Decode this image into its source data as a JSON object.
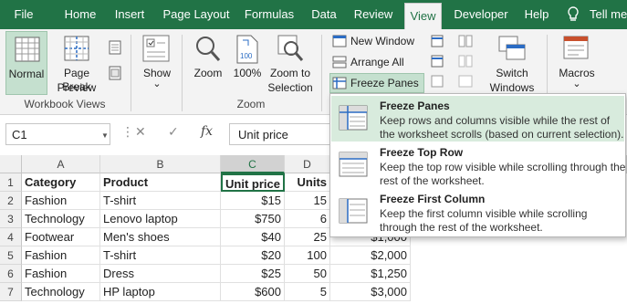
{
  "tabs": [
    "File",
    "Home",
    "Insert",
    "Page Layout",
    "Formulas",
    "Data",
    "Review",
    "View",
    "Developer",
    "Help",
    "Tell me"
  ],
  "active_tab": "View",
  "colors": {
    "brand": "#217346",
    "selected_bg": "#c5e0cf",
    "hover_bg": "#d8ebdd"
  },
  "ribbon": {
    "workbook_views": {
      "normal": "Normal",
      "page_break_line1": "Page Break",
      "page_break_line2": "Preview",
      "label": "Workbook Views"
    },
    "show": {
      "label": "Show",
      "arrow": "⌄"
    },
    "zoom": {
      "zoom": "Zoom",
      "hundred": "100%",
      "zoom_sel_line1": "Zoom to",
      "zoom_sel_line2": "Selection",
      "label": "Zoom"
    },
    "window": {
      "new_window": "New Window",
      "arrange_all": "Arrange All",
      "freeze_panes": "Freeze Panes",
      "switch_line1": "Switch",
      "switch_line2": "Windows"
    },
    "macros": {
      "label": "Macros"
    }
  },
  "formula_bar": {
    "name_box": "C1",
    "fx": "fx",
    "formula": "Unit price"
  },
  "grid": {
    "columns": [
      "A",
      "B",
      "C",
      "D"
    ],
    "selected_column": "C",
    "rows": [
      "1",
      "2",
      "3",
      "4",
      "5",
      "6",
      "7"
    ],
    "header": {
      "a": "Category",
      "b": "Product",
      "c": "Unit price",
      "d": "Units"
    },
    "data": [
      {
        "a": "Fashion",
        "b": "T-shirt",
        "c": "$15",
        "d": "15",
        "e": ""
      },
      {
        "a": "Technology",
        "b": "Lenovo laptop",
        "c": "$750",
        "d": "6",
        "e": ""
      },
      {
        "a": "Footwear",
        "b": "Men's shoes",
        "c": "$40",
        "d": "25",
        "e": "$1,000"
      },
      {
        "a": "Fashion",
        "b": "T-shirt",
        "c": "$20",
        "d": "100",
        "e": "$2,000"
      },
      {
        "a": "Fashion",
        "b": "Dress",
        "c": "$25",
        "d": "50",
        "e": "$1,250"
      },
      {
        "a": "Technology",
        "b": "HP laptop",
        "c": "$600",
        "d": "5",
        "e": "$3,000"
      }
    ]
  },
  "freeze_menu": [
    {
      "title": "Freeze Panes",
      "desc": "Keep rows and columns visible while the rest of the worksheet scrolls (based on current selection)."
    },
    {
      "title": "Freeze Top Row",
      "desc": "Keep the top row visible while scrolling through the rest of the worksheet."
    },
    {
      "title": "Freeze First Column",
      "desc": "Keep the first column visible while scrolling through the rest of the worksheet."
    }
  ]
}
